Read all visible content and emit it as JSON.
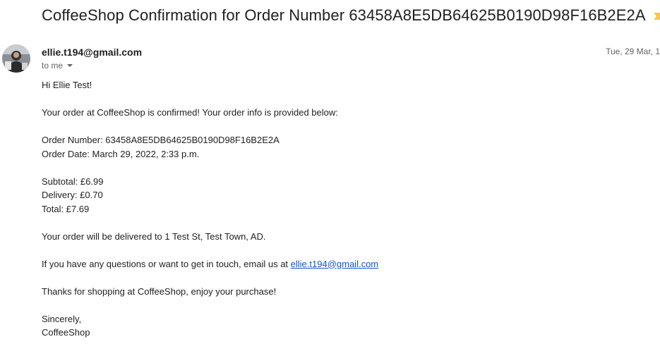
{
  "email": {
    "subject": "CoffeeShop Confirmation for Order Number 63458A8E5DB64625B0190D98F16B2E2A",
    "importance_icon": "importance-marker-icon",
    "importance_color": "#f2c94c",
    "sender": "ellie.t194@gmail.com",
    "date": "Tue, 29 Mar, 1",
    "to_label": "to me",
    "avatar_icon": "avatar",
    "body": {
      "greeting": "Hi Ellie Test!",
      "intro": "Your order at CoffeeShop is confirmed! Your order info is provided below:",
      "order_number": "Order Number: 63458A8E5DB64625B0190D98F16B2E2A",
      "order_date": "Order Date: March 29, 2022, 2:33 p.m.",
      "subtotal": "Subtotal: £6.99",
      "delivery": "Delivery: £0.70",
      "total": "Total: £7.69",
      "delivery_address": "Your order will be delivered to 1 Test St, Test Town, AD.",
      "contact_prefix": "If you have any questions or want to get in touch, email us at ",
      "contact_email": "ellie.t194@gmail.com",
      "thanks": "Thanks for shopping at CoffeeShop, enjoy your purchase!",
      "signoff": "Sincerely,",
      "signature": "CoffeeShop"
    }
  },
  "colors": {
    "link": "#1155cc",
    "secondary_text": "#5f6368"
  }
}
